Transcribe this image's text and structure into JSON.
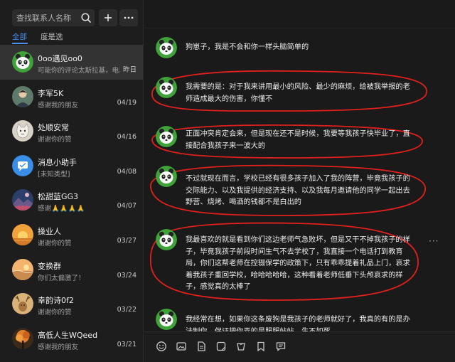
{
  "search": {
    "placeholder": "查找联系人名称"
  },
  "tabs": {
    "all": "全部",
    "dense": "度是选"
  },
  "contacts": [
    {
      "name": "0oo遇见oo0",
      "preview": "可能你的评论太斯拉基，电脑",
      "date": "昨日",
      "avatar": "panda"
    },
    {
      "name": "李军5K",
      "preview": "感谢我的朋友",
      "date": "04/19",
      "avatar": "person"
    },
    {
      "name": "处顺安常",
      "preview": "谢谢你的赞",
      "date": "04/16",
      "avatar": "cat"
    },
    {
      "name": "消息小助手",
      "preview": "[未知类型]",
      "date": "04/08",
      "avatar": "assistant"
    },
    {
      "name": "松甜蓝GG3",
      "preview": "感谢🙏🙏🙏🙏",
      "date": "04/07",
      "avatar": "landscape"
    },
    {
      "name": "操业人",
      "preview": "谢谢你的赞",
      "date": "03/27",
      "avatar": "sunset"
    },
    {
      "name": "变换群",
      "preview": "你们太偏激了！",
      "date": "03/24",
      "avatar": "beach"
    },
    {
      "name": "幸韵诗0f2",
      "preview": "谢谢你的赞",
      "date": "03/22",
      "avatar": "deer"
    },
    {
      "name": "高低人生WQeed",
      "preview": "感谢我的朋友",
      "date": "03/21",
      "avatar": "tree"
    }
  ],
  "messages": [
    "狗崽子，我是不会和你一样头脑简单的",
    "我需要的是：对于我来讲用最小的风险、最少的麻烦，给被我举报的老师造成最大的伤害，你懂不",
    "正面冲突肯定会来，但是现在还不是时候，我要等我孩子快毕业了，直接配合我孩子来一波大的",
    "不过就现在而言，学校已经有很多孩子加入了我的阵营，毕竟我孩子的交际能力、以及我提供的经济支持、以及我每月邀请他的同学一起出去野营、烧烤、喝酒的钱都不是白出的",
    "我最喜欢的就是看到你们这边老师气急败坏，但是又干不掉我孩子的样子，毕竟我孩子前段时间生气不去学校了，我直接一个电话打到教育局，你们这帮老师在控辍保学的政策下，只有乖乖提着礼品上门，哀求着我孩子重回学校，哈哈哈哈哈，这种看着老师低垂下头颅哀求的样子，感觉真的太棒了",
    "我经常在想，如果你这条废狗是我孩子的老师就好了，我真的有的是办法制你，保证把你弄的是服服帖帖、生不如死"
  ],
  "colors": {
    "accent": "#4b8ff0",
    "highlight_ring": "#e0201c",
    "avatar_green": "#3fa33a"
  },
  "icons": {
    "search": "search-icon",
    "add": "plus-icon",
    "more": "more-icon",
    "emoji": "emoji-icon",
    "image": "image-icon",
    "file": "file-icon",
    "sticker": "sticker-icon",
    "history": "history-icon",
    "bookmark": "bookmark-icon",
    "comment": "comment-icon"
  }
}
